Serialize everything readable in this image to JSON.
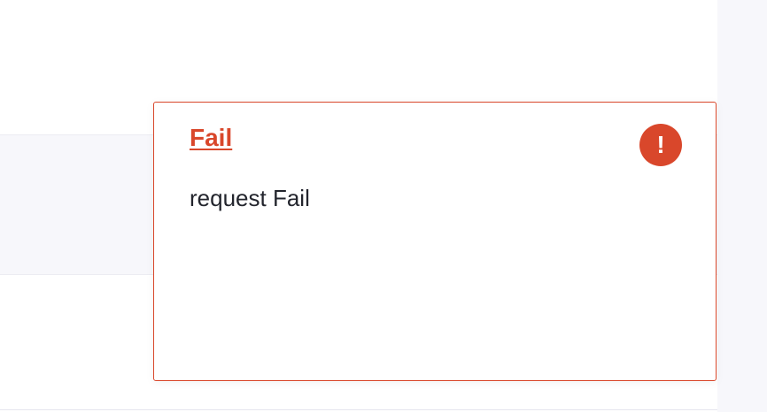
{
  "notification": {
    "title": "Fail",
    "message": "request Fail",
    "icon": "exclamation-icon",
    "icon_glyph": "!",
    "accent_color": "#d9472b"
  }
}
